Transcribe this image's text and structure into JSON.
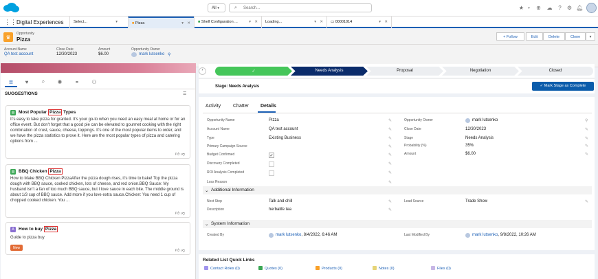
{
  "global_header": {
    "scope": "All",
    "search_placeholder": "Search..."
  },
  "nav": {
    "app_name": "Digital Experiences",
    "tabs": [
      {
        "label": "Select..."
      },
      {
        "label": "Pizza"
      },
      {
        "label": "Shelf Configuration ..."
      },
      {
        "label": "Loading..."
      },
      {
        "label": "00001014"
      }
    ]
  },
  "record": {
    "object": "Opportunity",
    "name": "Pizza",
    "actions": {
      "follow": "+ Follow",
      "edit": "Edit",
      "delete": "Delete",
      "clone": "Clone"
    },
    "highlights": [
      {
        "label": "Account Name",
        "value": "QA test account"
      },
      {
        "label": "Close Date",
        "value": "12/30/2023"
      },
      {
        "label": "Amount",
        "value": "$6.00"
      },
      {
        "label": "Opportunity Owner",
        "value": "mark lutsenko"
      }
    ]
  },
  "suggestions": {
    "title": "SUGGESTIONS",
    "cards": [
      {
        "title_pre": "Most Popular ",
        "title_hl": "Pizza",
        "title_post": " Types",
        "body": "It's easy to take pizza for granted. It's your go-to when you need an easy meal at home or for an office event. But don't forget that a good pie can be elevated to gourmet cooking with the right combination of crust, sauce, cheese, toppings. It's one of the most popular items to order, and we have the pizza statistics to prove it. Here are the most popular types of pizza and catering options from ..."
      },
      {
        "title_pre": "BBQ Chicken ",
        "title_hl": "Pizza",
        "title_post": "",
        "body": "How to Make BBQ Chicken PizzaAfter the pizza dough rises, it's time to bake! Top the pizza dough with BBQ sauce, cooked chicken, lots of cheese, and red onion.BBQ Sauce: My husband isn't a fan of too much BBQ sauce, but I love sauce in each bite. The middle ground is about 1/3 cup of BBQ sauce. Add more if you love extra sauce.Chicken: You need 1 cup of chopped cooked chicken. You ..."
      },
      {
        "title_pre": "How to buy ",
        "title_hl": "Pizza",
        "title_post": "",
        "body": "Guide to pizza buy",
        "badge": "New"
      }
    ]
  },
  "path": {
    "stages": [
      "",
      "Needs Analysis",
      "Proposal",
      "Negotiation",
      "Closed"
    ],
    "current_label": "Stage: Needs Analysis",
    "mark_button": "✓ Mark Stage as Complete"
  },
  "detail_tabs": [
    "Activity",
    "Chatter",
    "Details"
  ],
  "fields_left": [
    {
      "label": "Opportunity Name",
      "value": "Pizza"
    },
    {
      "label": "Account Name",
      "value": "QA test account"
    },
    {
      "label": "Type",
      "value": "Existing Business"
    },
    {
      "label": "Primary Campaign Source",
      "value": ""
    },
    {
      "label": "Budget Confirmed",
      "value": "✓"
    },
    {
      "label": "Discovery Completed",
      "value": ""
    },
    {
      "label": "ROI Analysis Completed",
      "value": ""
    },
    {
      "label": "Loss Reason",
      "value": ""
    }
  ],
  "fields_right": [
    {
      "label": "Opportunity Owner",
      "value": "mark lutsenko"
    },
    {
      "label": "Close Date",
      "value": "12/30/2023"
    },
    {
      "label": "Stage",
      "value": "Needs Analysis"
    },
    {
      "label": "Probability (%)",
      "value": "35%"
    },
    {
      "label": "Amount",
      "value": "$6.00"
    }
  ],
  "additional": {
    "title": "Additional Information",
    "next_step_label": "Next Step",
    "next_step": "Talk and chill",
    "description_label": "Description",
    "description": "herbalife tea",
    "lead_source_label": "Lead Source",
    "lead_source": "Trade Show"
  },
  "system": {
    "title": "System Information",
    "created_label": "Created By",
    "created_by": "mark lutsenko",
    "created_date": ", 8/4/2022, 6:46 AM",
    "modified_label": "Last Modified By",
    "modified_by": "mark lutsenko",
    "modified_date": ", 9/8/2022, 10:26 AM"
  },
  "related": {
    "title": "Related List Quick Links",
    "links": [
      {
        "label": "Contact Roles (0)",
        "color": "#a094ed"
      },
      {
        "label": "Quotes (0)",
        "color": "#3ba755"
      },
      {
        "label": "Products (0)",
        "color": "#f9a12a"
      },
      {
        "label": "Notes (0)",
        "color": "#e6d478"
      },
      {
        "label": "Files (0)",
        "color": "#c7b6e5"
      }
    ]
  }
}
